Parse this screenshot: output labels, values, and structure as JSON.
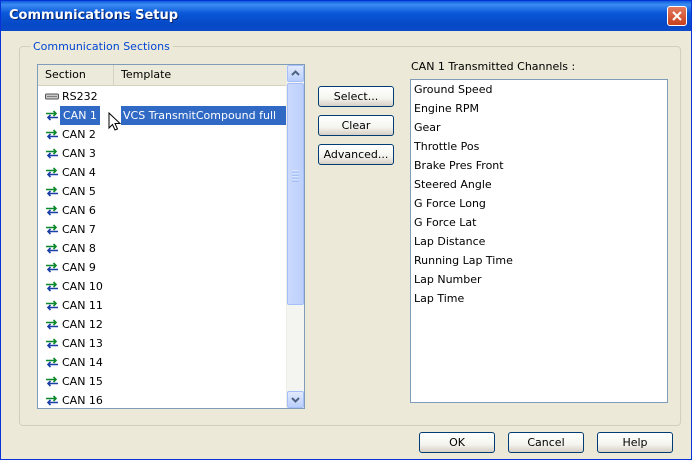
{
  "window": {
    "title": "Communications Setup"
  },
  "group": {
    "label": "Communication Sections"
  },
  "listview": {
    "columns": [
      "Section",
      "Template"
    ],
    "rows": [
      {
        "section": "RS232",
        "icon": "serial-port-icon"
      },
      {
        "section": "CAN 1",
        "template": "VCS TransmitCompound full",
        "icon": "can-arrows-icon"
      },
      {
        "section": "CAN 2",
        "icon": "can-arrows-icon"
      },
      {
        "section": "CAN 3",
        "icon": "can-arrows-icon"
      },
      {
        "section": "CAN 4",
        "icon": "can-arrows-icon"
      },
      {
        "section": "CAN 5",
        "icon": "can-arrows-icon"
      },
      {
        "section": "CAN 6",
        "icon": "can-arrows-icon"
      },
      {
        "section": "CAN 7",
        "icon": "can-arrows-icon"
      },
      {
        "section": "CAN 8",
        "icon": "can-arrows-icon"
      },
      {
        "section": "CAN 9",
        "icon": "can-arrows-icon"
      },
      {
        "section": "CAN 10",
        "icon": "can-arrows-icon"
      },
      {
        "section": "CAN 11",
        "icon": "can-arrows-icon"
      },
      {
        "section": "CAN 12",
        "icon": "can-arrows-icon"
      },
      {
        "section": "CAN 13",
        "icon": "can-arrows-icon"
      },
      {
        "section": "CAN 14",
        "icon": "can-arrows-icon"
      },
      {
        "section": "CAN 15",
        "icon": "can-arrows-icon"
      },
      {
        "section": "CAN 16",
        "icon": "can-arrows-icon"
      }
    ],
    "selected_section": "CAN 1"
  },
  "buttons": {
    "select": "Select...",
    "clear": "Clear",
    "advanced": "Advanced...",
    "ok": "OK",
    "cancel": "Cancel",
    "help": "Help"
  },
  "channels": {
    "label": "CAN 1 Transmitted Channels :",
    "items": [
      "Ground Speed",
      "Engine RPM",
      "Gear",
      "Throttle Pos",
      "Brake Pres Front",
      "Steered Angle",
      "G Force Long",
      "G Force Lat",
      "Lap Distance",
      "Running Lap Time",
      "Lap Number",
      "Lap Time"
    ]
  },
  "colors": {
    "titlebar": "#0a58d8",
    "selection": "#316ac5",
    "group_label": "#0046d5",
    "dialog_bg": "#ece9d8"
  }
}
